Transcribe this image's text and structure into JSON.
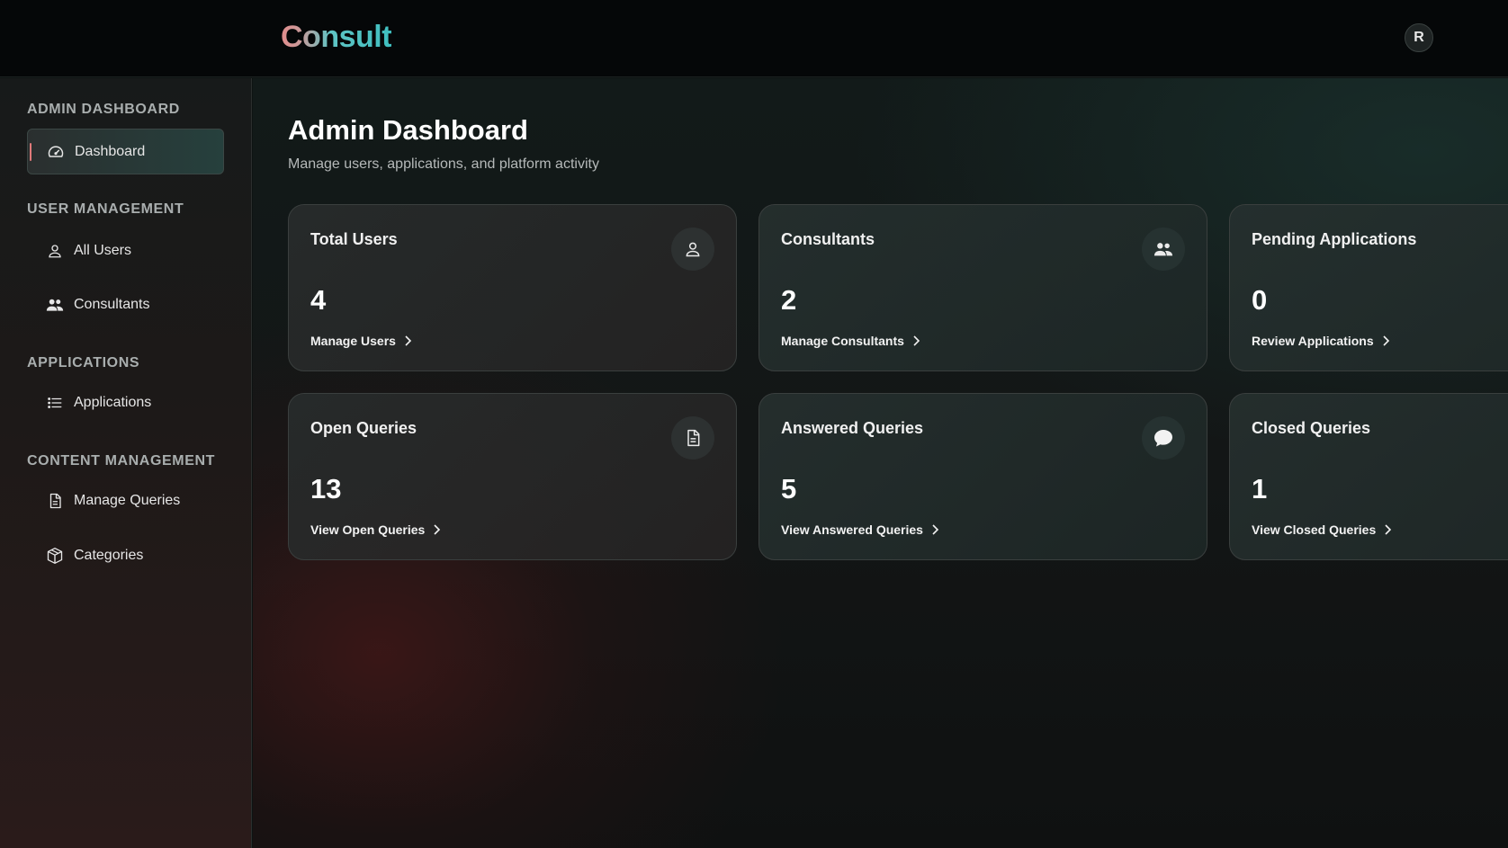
{
  "header": {
    "logo": "Consult",
    "avatar_initial": "R"
  },
  "sidebar": {
    "sections": [
      {
        "title": "ADMIN DASHBOARD",
        "items": [
          {
            "label": "Dashboard",
            "icon": "gauge-icon",
            "active": true
          }
        ]
      },
      {
        "title": "USER MANAGEMENT",
        "items": [
          {
            "label": "All Users",
            "icon": "user-icon"
          },
          {
            "label": "Consultants",
            "icon": "users-icon"
          }
        ]
      },
      {
        "title": "APPLICATIONS",
        "items": [
          {
            "label": "Applications",
            "icon": "list-icon"
          }
        ]
      },
      {
        "title": "CONTENT MANAGEMENT",
        "items": [
          {
            "label": "Manage Queries",
            "icon": "document-icon"
          },
          {
            "label": "Categories",
            "icon": "box-icon"
          }
        ]
      }
    ]
  },
  "main": {
    "title": "Admin Dashboard",
    "subtitle": "Manage users, applications, and platform activity",
    "cards": [
      {
        "title": "Total Users",
        "value": "4",
        "link": "Manage Users",
        "icon": "user-icon"
      },
      {
        "title": "Consultants",
        "value": "2",
        "link": "Manage Consultants",
        "icon": "users-icon"
      },
      {
        "title": "Pending Applications",
        "value": "0",
        "link": "Review Applications",
        "icon": "list-icon"
      },
      {
        "title": "Open Queries",
        "value": "13",
        "link": "View Open Queries",
        "icon": "document-icon"
      },
      {
        "title": "Answered Queries",
        "value": "5",
        "link": "View Answered Queries",
        "icon": "chat-bubble-icon"
      },
      {
        "title": "Closed Queries",
        "value": "1",
        "link": "View Closed Queries",
        "icon": "check-icon"
      }
    ]
  },
  "colors": {
    "accent_red": "#e07a7a",
    "accent_teal": "#3fbfc0",
    "background": "#0e1312"
  }
}
